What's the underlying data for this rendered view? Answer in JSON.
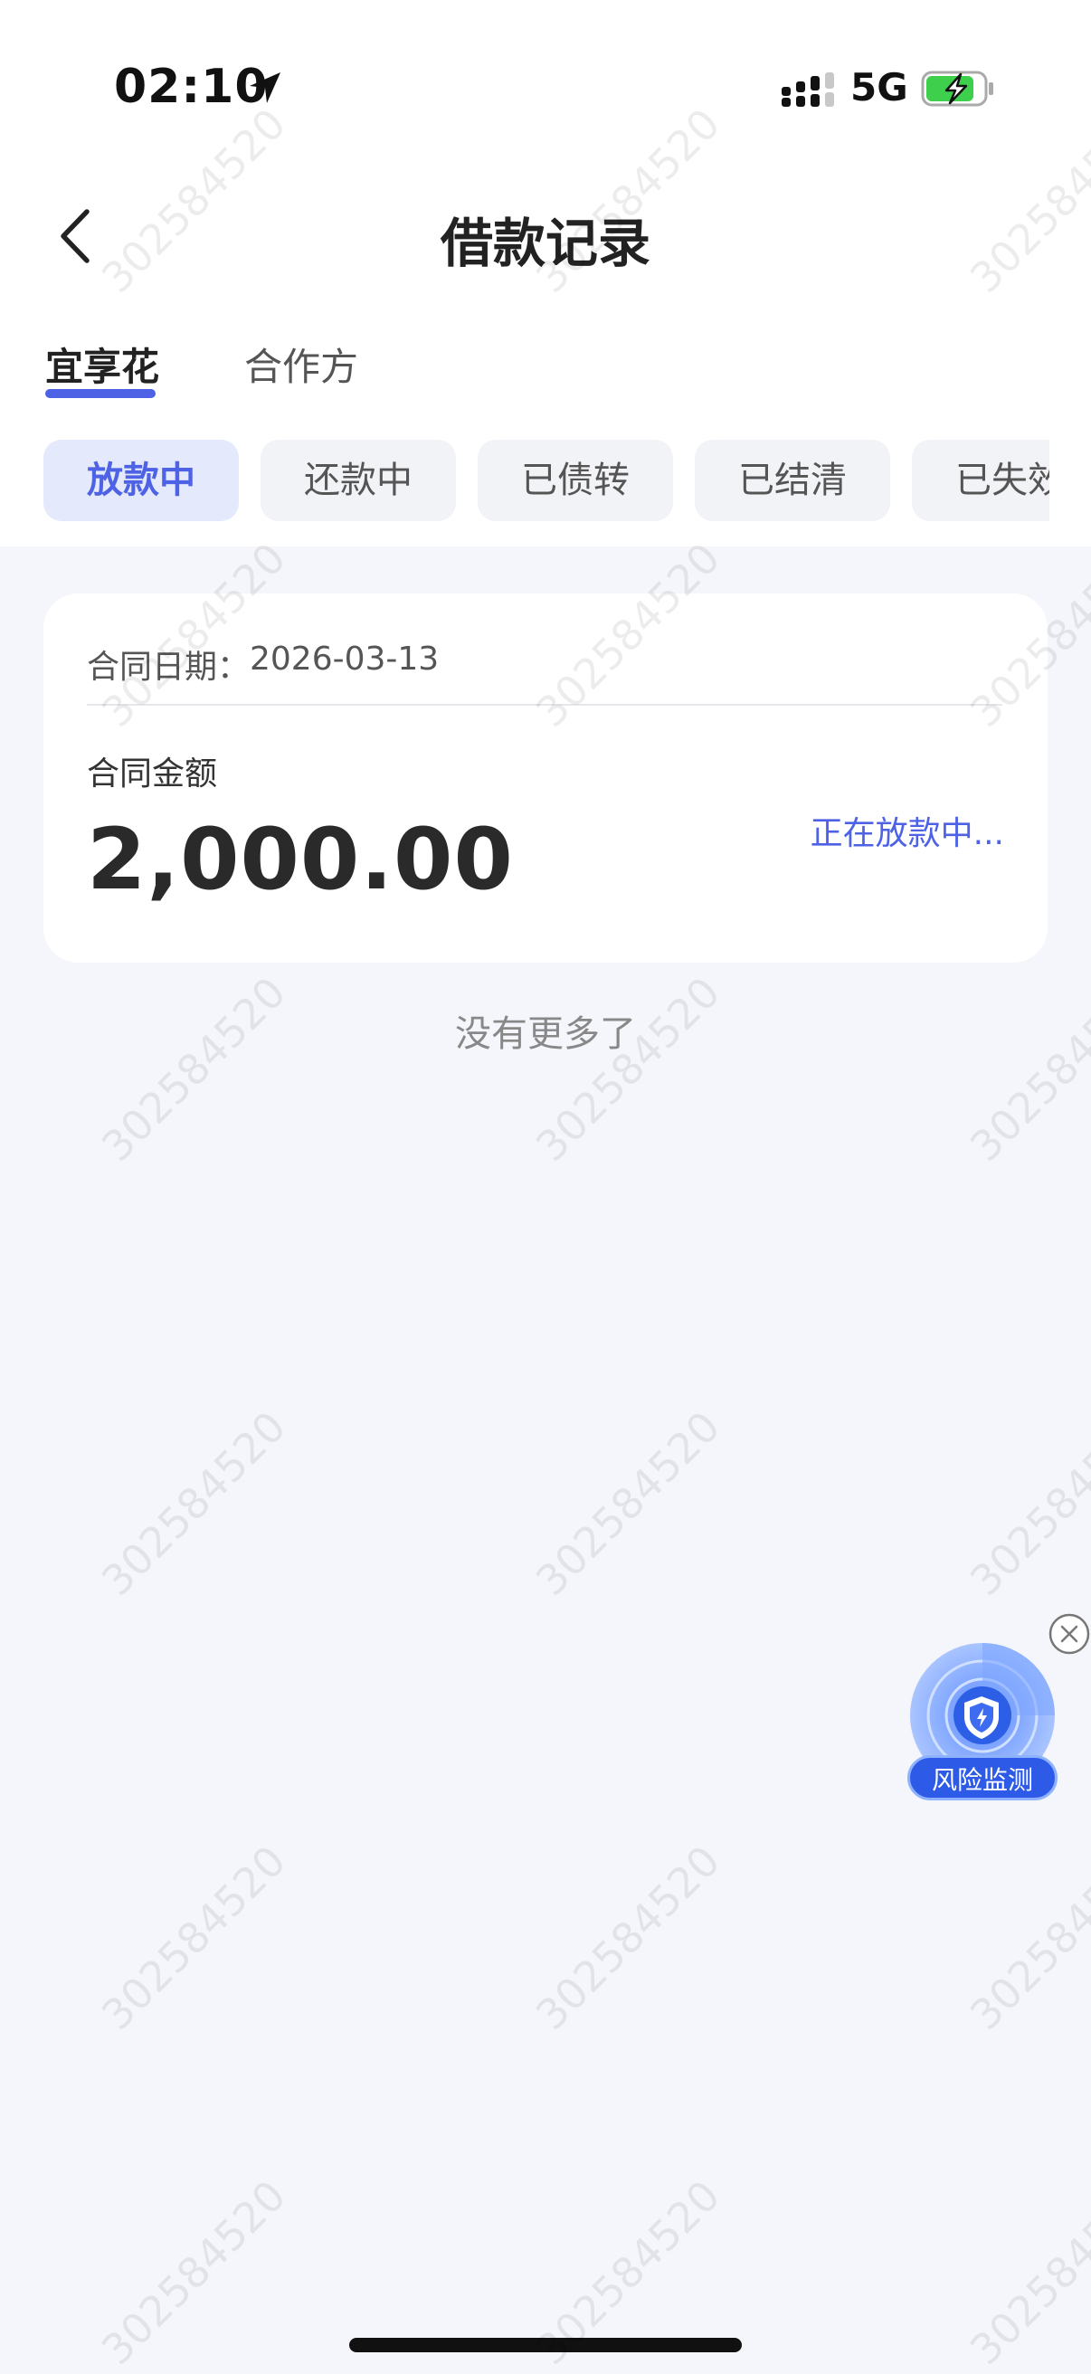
{
  "status_bar": {
    "time": "02:10",
    "network": "5G"
  },
  "header": {
    "title": "借款记录"
  },
  "tabs": [
    {
      "label": "宜享花"
    },
    {
      "label": "合作方"
    }
  ],
  "filters": [
    {
      "label": "放款中"
    },
    {
      "label": "还款中"
    },
    {
      "label": "已债转"
    },
    {
      "label": "已结清"
    },
    {
      "label": "已失效"
    }
  ],
  "record": {
    "date_label": "合同日期：",
    "date": "2026-03-13",
    "amount_label": "合同金额",
    "amount": "2,000.00",
    "status": "正在放款中..."
  },
  "list_footer": "没有更多了",
  "floating_widget": {
    "label": "风险监测",
    "icon": "shield-icon"
  },
  "watermark": "302584520",
  "colors": {
    "accent": "#4d62e4",
    "background": "#f5f6fb",
    "chip_active_bg": "#e4e9fc"
  }
}
